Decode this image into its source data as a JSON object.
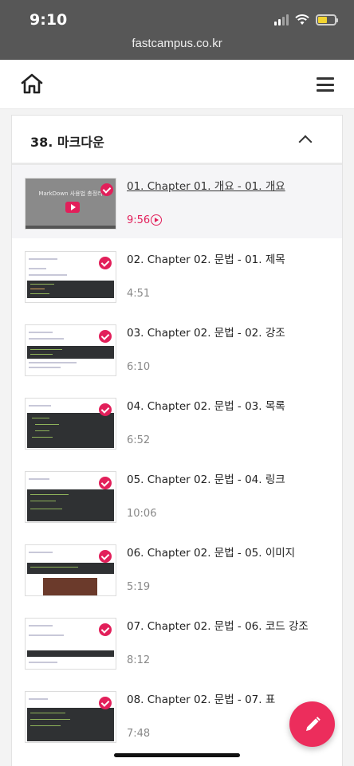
{
  "status_bar": {
    "time": "9:10",
    "url": "fastcampus.co.kr"
  },
  "section": {
    "title": "38. 마크다운"
  },
  "lessons": [
    {
      "title": "01. Chapter 01. 개요 - 01. 개요",
      "duration": "9:56",
      "thumb_caption": "MarkDown 사용법 총정리"
    },
    {
      "title": "02. Chapter 02. 문법 - 01. 제목",
      "duration": "4:51"
    },
    {
      "title": "03. Chapter 02. 문법 - 02. 강조",
      "duration": "6:10"
    },
    {
      "title": "04. Chapter 02. 문법 - 03. 목록",
      "duration": "6:52"
    },
    {
      "title": "05. Chapter 02. 문법 - 04. 링크",
      "duration": "10:06"
    },
    {
      "title": "06. Chapter 02. 문법 - 05. 이미지",
      "duration": "5:19"
    },
    {
      "title": "07. Chapter 02. 문법 - 06. 코드 강조",
      "duration": "8:12"
    },
    {
      "title": "08. Chapter 02. 문법 - 07. 표",
      "duration": "7:48"
    }
  ],
  "colors": {
    "accent": "#e21f5a",
    "fab": "#ec2d5c",
    "statusbar": "#575757"
  }
}
